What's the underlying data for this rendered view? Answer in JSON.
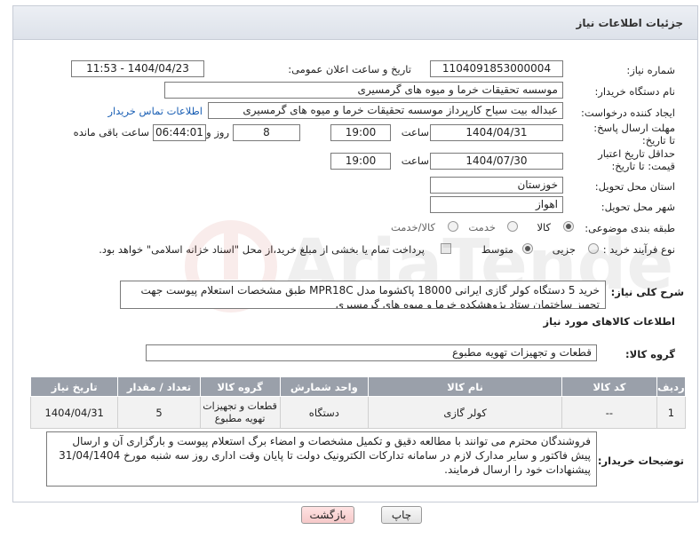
{
  "header": {
    "title": "جزئیات اطلاعات نیاز"
  },
  "fields": {
    "need_number_label": "شماره نیاز:",
    "need_number": "1104091853000004",
    "announce_label": "تاریخ و ساعت اعلان عمومی:",
    "announce_value": "1404/04/23 - 11:53",
    "buyer_org_label": "نام دستگاه خریدار:",
    "buyer_org": "موسسه تحقیقات خرما و میوه های گرمسیری",
    "creator_label": "ایجاد کننده درخواست:",
    "creator": "عبداله بیت سیاح کارپرداز موسسه تحقیقات خرما و میوه های گرمسیری",
    "contact_link": "اطلاعات تماس خریدار",
    "deadline_label": "مهلت ارسال پاسخ: تا تاریخ:",
    "deadline_date": "1404/04/31",
    "time_label": "ساعت",
    "deadline_time": "19:00",
    "days_value": "8",
    "days_label": "روز و",
    "remaining_time": "06:44:01",
    "remaining_label": "ساعت باقی مانده",
    "validity_label": "حداقل تاریخ اعتبار قیمت: تا تاریخ:",
    "validity_date": "1404/07/30",
    "validity_time": "19:00",
    "province_label": "استان محل تحویل:",
    "province": "خوزستان",
    "city_label": "شهر محل تحویل:",
    "city": "اهواز",
    "category_label": "طبقه بندی موضوعی:",
    "category_options": [
      "کالا",
      "خدمت",
      "کالا/خدمت"
    ],
    "process_label": "نوع فرآیند خرید :",
    "process_options": [
      "جزیی",
      "متوسط"
    ],
    "payment_note": "پرداخت تمام یا بخشی از مبلغ خرید،از محل \"اسناد خزانه اسلامی\" خواهد بود."
  },
  "description": {
    "label": "شرح کلی نیاز:",
    "text": "خرید 5 دستگاه کولر گازی ایرانی 18000 پاکشوما مدل MPR18C طبق مشخصات استعلام پیوست جهت تجهیز ساختمان ستاد پژوهشکده خرما و میوه های گرمسیری"
  },
  "goods_info_title": "اطلاعات کالاهای مورد نیاز",
  "goods_group": {
    "label": "گروه کالا:",
    "value": "قطعات و تجهیزات تهویه مطبوع"
  },
  "table": {
    "headers": [
      "ردیف",
      "کد کالا",
      "نام کالا",
      "واحد شمارش",
      "گروه کالا",
      "تعداد / مقدار",
      "تاریخ نیاز"
    ],
    "rows": [
      [
        "1",
        "--",
        "کولر گازی",
        "دستگاه",
        "قطعات و تجهیزات تهویه مطبوع",
        "5",
        "1404/04/31"
      ]
    ]
  },
  "buyer_notes": {
    "label": "توضیحات خریدار:",
    "text": "فروشندگان محترم می توانند با مطالعه دقیق و تکمیل مشخصات و امضاء برگ استعلام پیوست و بارگزاری آن و ارسال پیش فاکتور و سایر مدارک لازم در سامانه تدارکات الکترونیک دولت تا پایان وقت اداری روز سه شنبه مورخ 31/04/1404 پیشنهادات خود را ارسال فرمایند."
  },
  "buttons": {
    "print": "چاپ",
    "back": "بازگشت"
  },
  "colors": {
    "table_header": "#9aa0aa",
    "back_button": "#f6c9c9",
    "link": "#1a5fb4"
  }
}
